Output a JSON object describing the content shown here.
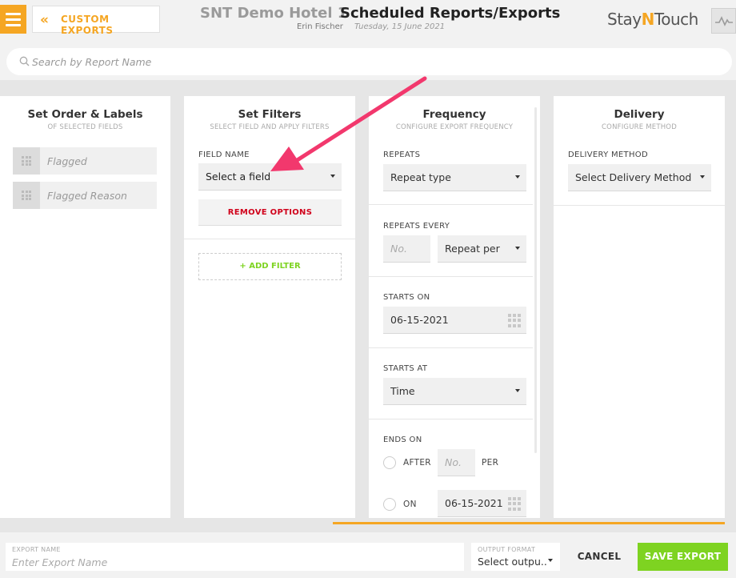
{
  "header": {
    "back_label": "CUSTOM EXPORTS",
    "hotel_name": "SNT Demo Hotel 1",
    "page_title": "Scheduled Reports/Exports",
    "user_name": "Erin Fischer",
    "date": "Tuesday, 15 June 2021",
    "brand_a": "Stay",
    "brand_n": "N",
    "brand_b": "Touch",
    "menu_icon": "hamburger-icon",
    "activity_icon": "activity-pulse-icon"
  },
  "search": {
    "placeholder": "Search by Report Name"
  },
  "order_panel": {
    "title": "Set Order & Labels",
    "subtitle": "OF SELECTED FIELDS",
    "fields": [
      "Flagged",
      "Flagged Reason"
    ]
  },
  "filters_panel": {
    "title": "Set Filters",
    "subtitle": "SELECT FIELD AND APPLY FILTERS",
    "field_name_label": "FIELD NAME",
    "field_select_value": "Select a field",
    "remove_label": "REMOVE OPTIONS",
    "add_label": "+ ADD FILTER"
  },
  "frequency_panel": {
    "title": "Frequency",
    "subtitle": "CONFIGURE EXPORT FREQUENCY",
    "repeats_label": "REPEATS",
    "repeats_value": "Repeat type",
    "repeats_every_label": "REPEATS EVERY",
    "repeats_every_placeholder": "No.",
    "repeat_per_value": "Repeat per",
    "starts_on_label": "STARTS ON",
    "starts_on_value": "06-15-2021",
    "starts_at_label": "STARTS AT",
    "starts_at_value": "Time",
    "ends_on_label": "ENDS ON",
    "after_label": "AFTER",
    "after_placeholder": "No.",
    "per_label": "PER",
    "on_label": "ON",
    "ends_on_date": "06-15-2021"
  },
  "delivery_panel": {
    "title": "Delivery",
    "subtitle": "CONFIGURE METHOD",
    "method_label": "DELIVERY METHOD",
    "method_value": "Select Delivery Method"
  },
  "footer": {
    "export_name_label": "EXPORT NAME",
    "export_name_placeholder": "Enter Export Name",
    "output_format_label": "OUTPUT FORMAT",
    "output_format_value": "Select outpu..",
    "cancel_label": "CANCEL",
    "save_label": "SAVE EXPORT"
  },
  "colors": {
    "accent_orange": "#f5a623",
    "save_green": "#7ed321",
    "remove_red": "#d0021b",
    "annotation_pink": "#f2386d"
  }
}
